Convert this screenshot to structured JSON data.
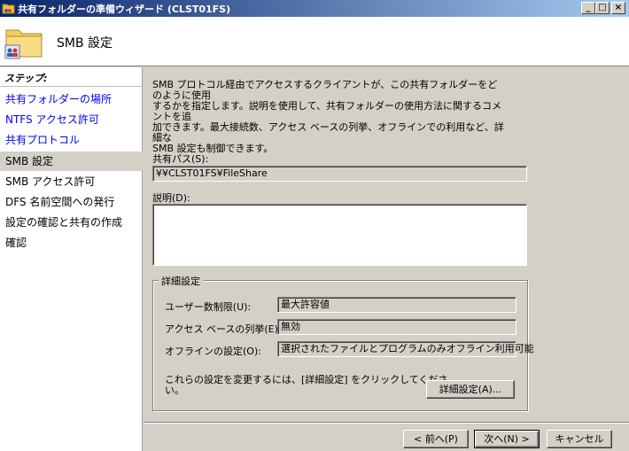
{
  "window": {
    "title": "共有フォルダーの準備ウィザード (CLST01FS)",
    "controls": {
      "minimize": "_",
      "maximize": "□",
      "close": "×"
    }
  },
  "header": {
    "title": "SMB 設定",
    "icon": "shared-folder-icon"
  },
  "sidebar": {
    "heading": "ステップ:",
    "steps": [
      {
        "label": "共有フォルダーの場所",
        "state": "link"
      },
      {
        "label": "NTFS アクセス許可",
        "state": "link"
      },
      {
        "label": "共有プロトコル",
        "state": "link"
      },
      {
        "label": "SMB 設定",
        "state": "current"
      },
      {
        "label": "SMB アクセス許可",
        "state": "plain"
      },
      {
        "label": "DFS 名前空間への発行",
        "state": "plain"
      },
      {
        "label": "設定の確認と共有の作成",
        "state": "plain"
      },
      {
        "label": "確認",
        "state": "plain"
      }
    ]
  },
  "main": {
    "intro_lines": [
      "SMB プロトコル経由でアクセスするクライアントが、この共有フォルダーをどのように使用",
      "するかを指定します。説明を使用して、共有フォルダーの使用方法に関するコメントを追",
      "加できます。最大接続数、アクセス ベースの列挙、オフラインでの利用など、詳細な",
      "SMB 設定も制御できます。"
    ],
    "share_path_label": "共有パス(S):",
    "share_path_value": "¥¥CLST01FS¥FileShare",
    "description_label": "説明(D):",
    "description_value": "",
    "advanced": {
      "title": "詳細設定",
      "rows": [
        {
          "label": "ユーザー数制限(U):",
          "value": "最大許容値"
        },
        {
          "label": "アクセス ベースの列挙(E):",
          "value": "無効"
        },
        {
          "label": "オフラインの設定(O):",
          "value": "選択されたファイルとプログラムのみオフライン利用可能"
        }
      ],
      "hint_line1": "これらの設定を変更するには、[詳細設定] をクリックしてくださ",
      "hint_line2": "い。",
      "button": "詳細設定(A)..."
    }
  },
  "footer": {
    "back": "< 前へ(P)",
    "next": "次へ(N) >",
    "cancel": "キャンセル"
  }
}
